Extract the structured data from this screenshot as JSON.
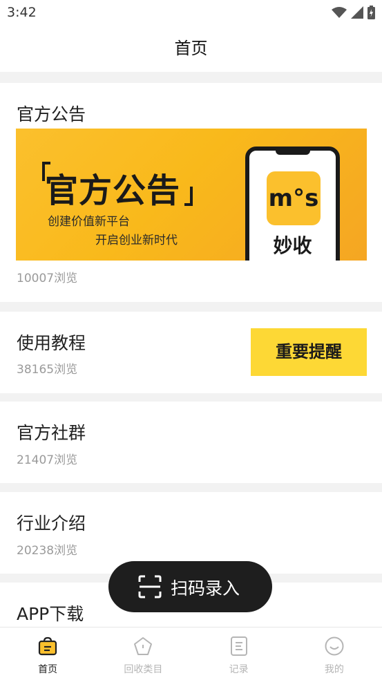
{
  "status_bar": {
    "time": "3:42",
    "icons": [
      "wifi-icon",
      "signal-icon",
      "battery-charging-icon"
    ]
  },
  "header": {
    "title": "首页"
  },
  "announcement": {
    "title": "官方公告",
    "views": "10007浏览",
    "banner": {
      "headline": "官方公告",
      "line1": "创建价值新平台",
      "line2": "开启创业新时代",
      "app_logo_text": "m°s",
      "app_name": "妙收"
    }
  },
  "tutorial": {
    "title": "使用教程",
    "views": "38165浏览",
    "reminder_label": "重要提醒"
  },
  "community": {
    "title": "官方社群",
    "views": "21407浏览"
  },
  "industry": {
    "title": "行业介绍",
    "views": "20238浏览"
  },
  "app_download": {
    "title": "APP下载"
  },
  "scan_button": {
    "label": "扫码录入",
    "icon": "scan-icon"
  },
  "tabbar": {
    "items": [
      {
        "label": "首页",
        "icon": "home-bag-icon",
        "active": true
      },
      {
        "label": "回收类目",
        "icon": "category-pentagon-icon",
        "active": false
      },
      {
        "label": "记录",
        "icon": "record-doc-icon",
        "active": false
      },
      {
        "label": "我的",
        "icon": "smile-icon",
        "active": false
      }
    ]
  },
  "colors": {
    "accent": "#fbc02d",
    "remind_bg": "#fdd835",
    "scan_bg": "#1e1e1e",
    "muted": "#9a9a9a"
  }
}
